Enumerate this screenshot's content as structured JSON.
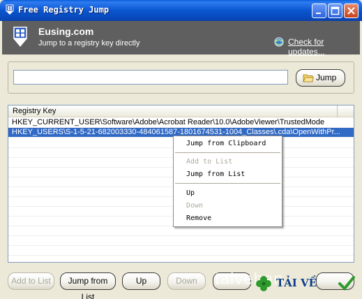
{
  "window": {
    "title": "Free Registry Jump",
    "minimize_icon": "minimize-icon",
    "maximize_icon": "maximize-icon",
    "close_icon": "close-icon"
  },
  "header": {
    "brand": "Eusing.com",
    "tagline": "Jump to a registry key directly",
    "update_link": "Check for updates...",
    "bg_color": "#5f5f5f"
  },
  "input": {
    "value": "",
    "placeholder": "",
    "jump_label": "Jump"
  },
  "list": {
    "column_header": "Registry Key",
    "rows": [
      {
        "text": "HKEY_CURRENT_USER\\Software\\Adobe\\Acrobat Reader\\10.0\\AdobeViewer\\TrustedMode",
        "selected": false
      },
      {
        "text": "HKEY_USERS\\S-1-5-21-682003330-484061587-1801674531-1004_Classes\\.cda\\OpenWithPr...",
        "selected": true
      }
    ],
    "selection_color": "#316ac5"
  },
  "context_menu": {
    "items": [
      {
        "label": "Jump from Clipboard",
        "enabled": true
      },
      {
        "label": "Add to List",
        "enabled": false
      },
      {
        "label": "Jump from List",
        "enabled": true
      },
      {
        "label": "Up",
        "enabled": true
      },
      {
        "label": "Down",
        "enabled": false
      },
      {
        "label": "Remove",
        "enabled": true
      }
    ]
  },
  "bottom_buttons": {
    "add_to_list": "Add to List",
    "jump_from_list": "Jump from List",
    "up": "Up",
    "down": "Down"
  },
  "watermark": {
    "text": "taiveban",
    "badge_text": "TẢI VỀ"
  }
}
